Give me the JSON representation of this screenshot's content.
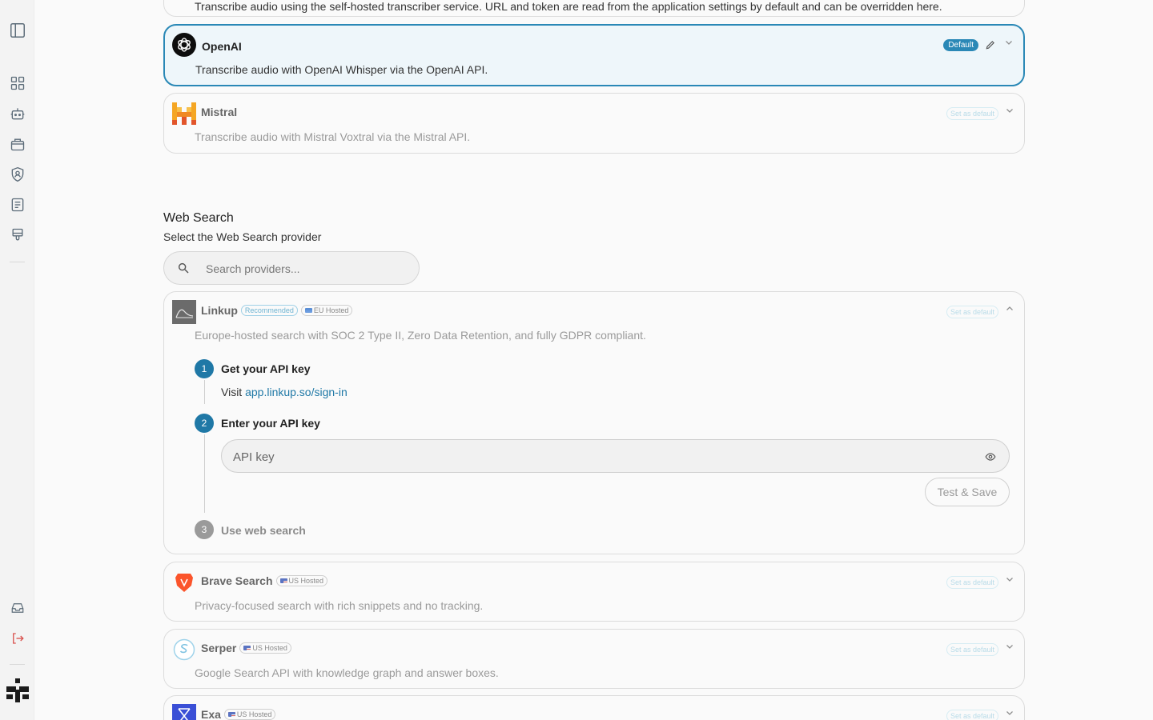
{
  "top_card": {
    "desc": "Transcribe audio using the self-hosted transcriber service. URL and token are read from the application settings by default and can be overridden here."
  },
  "transcription_providers": [
    {
      "name": "OpenAI",
      "desc": "Transcribe audio with OpenAI Whisper via the OpenAI API.",
      "badge": "Default"
    },
    {
      "name": "Mistral",
      "desc": "Transcribe audio with Mistral Voxtral via the Mistral API.",
      "set_default": "Set as default"
    }
  ],
  "web_search": {
    "title": "Web Search",
    "subtitle": "Select the Web Search provider",
    "search_placeholder": "Search providers...",
    "linkup": {
      "name": "Linkup",
      "tags": [
        "Recommended",
        "EU Hosted"
      ],
      "desc": "Europe-hosted search with SOC 2 Type II, Zero Data Retention, and fully GDPR compliant.",
      "set_default": "Set as default",
      "steps": [
        {
          "num": "1",
          "label": "Get your API key"
        },
        {
          "num": "2",
          "label": "Enter your API key"
        },
        {
          "num": "3",
          "label": "Use web search"
        }
      ],
      "visit_prefix": "Visit",
      "visit_link": "app.linkup.so/sign-in",
      "api_placeholder": "API key",
      "test_save": "Test & Save"
    },
    "others": [
      {
        "name": "Brave Search",
        "tag": "US Hosted",
        "desc": "Privacy-focused search with rich snippets and no tracking.",
        "set_default": "Set as default"
      },
      {
        "name": "Serper",
        "tag": "US Hosted",
        "desc": "Google Search API with knowledge graph and answer boxes.",
        "set_default": "Set as default"
      },
      {
        "name": "Exa",
        "tag": "US Hosted",
        "set_default": "Set as default"
      }
    ]
  },
  "colors": {
    "accent": "#2a88b6",
    "active_bg": "#eef6fa",
    "step": "#1f78a6"
  }
}
